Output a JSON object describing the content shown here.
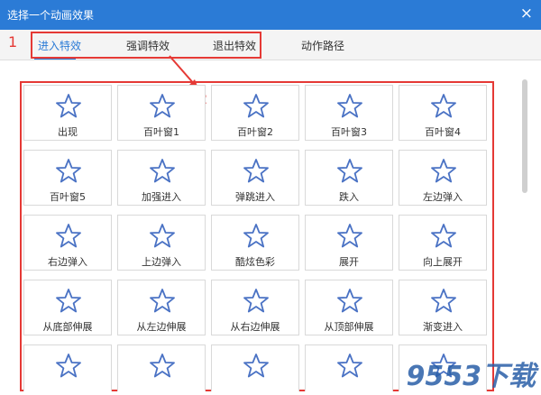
{
  "dialog": {
    "title": "选择一个动画效果",
    "close_glyph": "×"
  },
  "tabs": [
    {
      "label": "进入特效",
      "active": true
    },
    {
      "label": "强调特效",
      "active": false
    },
    {
      "label": "退出特效",
      "active": false
    },
    {
      "label": "动作路径",
      "active": false
    }
  ],
  "annotations": {
    "marker1": "1",
    "marker2": "2",
    "accent": "#e53935"
  },
  "effects": [
    {
      "label": "出现",
      "icon": "star-icon"
    },
    {
      "label": "百叶窗1",
      "icon": "star-icon"
    },
    {
      "label": "百叶窗2",
      "icon": "star-icon"
    },
    {
      "label": "百叶窗3",
      "icon": "star-icon"
    },
    {
      "label": "百叶窗4",
      "icon": "star-icon"
    },
    {
      "label": "百叶窗5",
      "icon": "star-icon"
    },
    {
      "label": "加强进入",
      "icon": "star-icon"
    },
    {
      "label": "弹跳进入",
      "icon": "star-icon"
    },
    {
      "label": "跌入",
      "icon": "star-icon"
    },
    {
      "label": "左边弹入",
      "icon": "star-icon"
    },
    {
      "label": "右边弹入",
      "icon": "star-icon"
    },
    {
      "label": "上边弹入",
      "icon": "star-icon"
    },
    {
      "label": "酷炫色彩",
      "icon": "star-icon"
    },
    {
      "label": "展开",
      "icon": "star-icon"
    },
    {
      "label": "向上展开",
      "icon": "star-icon"
    },
    {
      "label": "从底部伸展",
      "icon": "star-icon"
    },
    {
      "label": "从左边伸展",
      "icon": "star-icon"
    },
    {
      "label": "从右边伸展",
      "icon": "star-icon"
    },
    {
      "label": "从顶部伸展",
      "icon": "star-icon"
    },
    {
      "label": "渐变进入",
      "icon": "star-icon"
    },
    {
      "label": "",
      "icon": "star-icon"
    },
    {
      "label": "",
      "icon": "star-icon"
    },
    {
      "label": "",
      "icon": "star-icon"
    },
    {
      "label": "",
      "icon": "star-icon"
    },
    {
      "label": "",
      "icon": "star-icon"
    }
  ],
  "colors": {
    "title_bar": "#2b7bd6",
    "star": "#4a72c4"
  },
  "watermark": "9553下载"
}
